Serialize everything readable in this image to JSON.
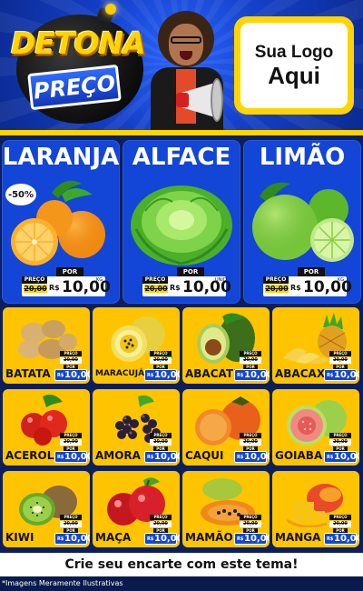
{
  "header": {
    "brand_top": "DETONA",
    "brand_bottom": "PREÇO",
    "logo_line1": "Sua Logo",
    "logo_line2": "Aqui"
  },
  "colors": {
    "accent_yellow": "#ffd400",
    "card_blue": "#1346d6",
    "card_yellow": "#ffc400",
    "header_blue": "#1440c8"
  },
  "featured": [
    {
      "name": "LARANJA",
      "discount": "-50%",
      "preco_label": "PREÇO",
      "por_label": "POR",
      "old_price": "20,00",
      "currency": "R$",
      "price": "10,00",
      "unit": "KG"
    },
    {
      "name": "ALFACE",
      "preco_label": "PREÇO",
      "por_label": "POR",
      "old_price": "20,00",
      "currency": "R$",
      "price": "10,00",
      "unit": "UNID"
    },
    {
      "name": "LIMÃO",
      "preco_label": "PREÇO",
      "por_label": "POR",
      "old_price": "20,00",
      "currency": "R$",
      "price": "10,00",
      "unit": "KG"
    }
  ],
  "products": [
    {
      "name": "BATATA",
      "preco_label": "PREÇO",
      "old_price": "20,00",
      "por_label": "POR",
      "currency": "R$",
      "price": "10,00",
      "icon": "potato-icon"
    },
    {
      "name": "MARACUJÁ",
      "preco_label": "PREÇO",
      "old_price": "20,00",
      "por_label": "POR",
      "currency": "R$",
      "price": "10,00",
      "icon": "passion-fruit-icon"
    },
    {
      "name": "ABACATE",
      "preco_label": "PREÇO",
      "old_price": "20,00",
      "por_label": "POR",
      "currency": "R$",
      "price": "10,00",
      "icon": "avocado-icon"
    },
    {
      "name": "ABACAXI",
      "preco_label": "PREÇO",
      "old_price": "20,00",
      "por_label": "POR",
      "currency": "R$",
      "price": "10,00",
      "icon": "pineapple-icon"
    },
    {
      "name": "ACEROLA",
      "preco_label": "PREÇO",
      "old_price": "20,00",
      "por_label": "POR",
      "currency": "R$",
      "price": "10,00",
      "icon": "acerola-icon"
    },
    {
      "name": "AMORA",
      "preco_label": "PREÇO",
      "old_price": "20,00",
      "por_label": "POR",
      "currency": "R$",
      "price": "10,00",
      "icon": "blackberry-icon"
    },
    {
      "name": "CAQUI",
      "preco_label": "PREÇO",
      "old_price": "20,00",
      "por_label": "POR",
      "currency": "R$",
      "price": "10,00",
      "icon": "persimmon-icon"
    },
    {
      "name": "GOIABA",
      "preco_label": "PREÇO",
      "old_price": "20,00",
      "por_label": "POR",
      "currency": "R$",
      "price": "10,00",
      "icon": "guava-icon"
    },
    {
      "name": "KIWI",
      "preco_label": "PREÇO",
      "old_price": "20,00",
      "por_label": "POR",
      "currency": "R$",
      "price": "10,00",
      "icon": "kiwi-icon"
    },
    {
      "name": "MAÇA",
      "preco_label": "PREÇO",
      "old_price": "20,00",
      "por_label": "POR",
      "currency": "R$",
      "price": "10,00",
      "icon": "apple-icon"
    },
    {
      "name": "MAMÃO",
      "preco_label": "PREÇO",
      "old_price": "20,00",
      "por_label": "POR",
      "currency": "R$",
      "price": "10,00",
      "icon": "papaya-icon"
    },
    {
      "name": "MANGA",
      "preco_label": "PREÇO",
      "old_price": "20,00",
      "por_label": "POR",
      "currency": "R$",
      "price": "10,00",
      "icon": "mango-icon"
    }
  ],
  "footer": {
    "cta": "Crie seu encarte com este tema!",
    "disclaimer": "*Imagens Meramente Ilustrativas"
  }
}
